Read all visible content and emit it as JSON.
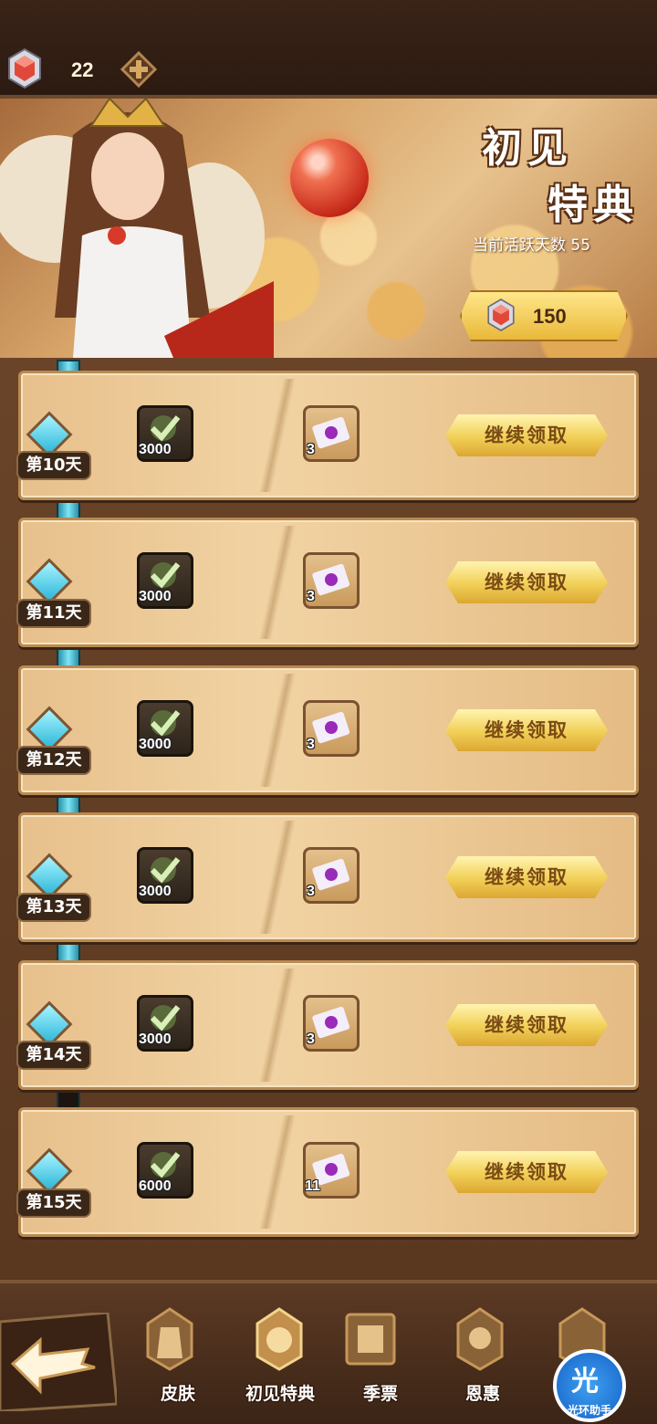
{
  "currency": {
    "gem_count": "22",
    "gem_icon": "red-gem-icon",
    "plus_icon": "plus-icon"
  },
  "banner": {
    "title_line1": "初见",
    "title_line2": "特典",
    "active_days_label": "当前活跃天数 55",
    "gem_reward": "150"
  },
  "rows": [
    {
      "day": "第10天",
      "item1_count": "3000",
      "item2_count": "3",
      "button": "继续领取"
    },
    {
      "day": "第11天",
      "item1_count": "3000",
      "item2_count": "3",
      "button": "继续领取"
    },
    {
      "day": "第12天",
      "item1_count": "3000",
      "item2_count": "3",
      "button": "继续领取"
    },
    {
      "day": "第13天",
      "item1_count": "3000",
      "item2_count": "3",
      "button": "继续领取"
    },
    {
      "day": "第14天",
      "item1_count": "3000",
      "item2_count": "3",
      "button": "继续领取"
    },
    {
      "day": "第15天",
      "item1_count": "6000",
      "item2_count": "11",
      "button": "继续领取"
    }
  ],
  "nav": {
    "skin": "皮肤",
    "first_gift": "初见特典",
    "season_pass": "季票",
    "grace": "恩惠",
    "helper_glyph": "光",
    "helper_label": "光环助手"
  },
  "colors": {
    "accent_gold": "#f1cf56",
    "timeline_cyan": "#7ee6f7",
    "panel_tan": "#f1d3a3"
  }
}
